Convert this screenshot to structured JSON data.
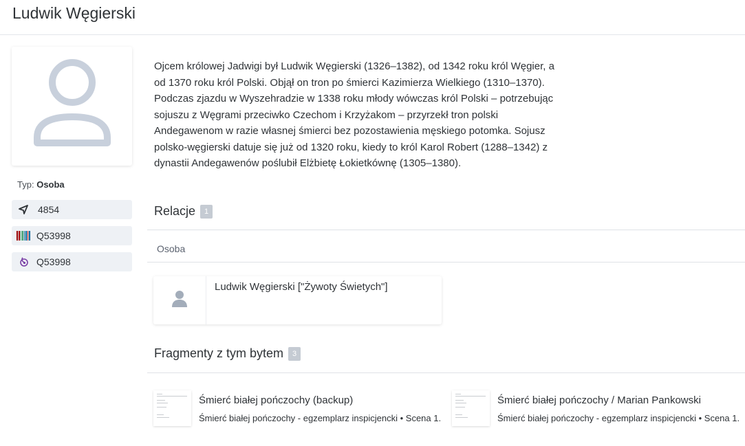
{
  "page": {
    "title": "Ludwik Węgierski"
  },
  "sidebar": {
    "type_label": "Typ:",
    "type_value": "Osoba",
    "identifiers": [
      {
        "icon": "network-icon",
        "value": "4854"
      },
      {
        "icon": "wikidata-icon",
        "value": "Q53998"
      },
      {
        "icon": "wikibase-icon",
        "value": "Q53998"
      }
    ]
  },
  "bio": "Ojcem królowej Jadwigi był Ludwik Węgierski (1326–1382), od 1342 roku król Węgier, a od 1370 roku król Polski. Objął on tron po śmierci Kazimierza Wielkiego (1310–1370). Podczas zjazdu w Wyszehradzie w 1338 roku młody wówczas król Polski – potrzebując sojuszu z Węgrami przeciwko Czechom i Krzyżakom – przyrzekł tron polski Andegawenom w razie własnej śmierci bez pozostawienia męskiego potomka. Sojusz polsko-węgierski datuje się już od 1320 roku, kiedy to król Karol Robert (1288–1342) z dynastii Andegawenów poślubił Elżbietę Łokietkównę (1305–1380).",
  "relations": {
    "title": "Relacje",
    "count": "1",
    "column": "Osoba",
    "items": [
      {
        "name": "Ludwik Węgierski [\"Żywoty Świetych\"]"
      }
    ]
  },
  "fragments": {
    "title": "Fragmenty z tym bytem",
    "count": "3",
    "items": [
      {
        "title": "Śmierć białej pończochy (backup)",
        "desc": "Śmierć białej pończochy - egzemplarz inspicjencki • Scena 1."
      },
      {
        "title": "Śmierć białej pończochy / Marian Pankowski",
        "desc": "Śmierć białej pończochy - egzemplarz inspicjencki • Scena 1."
      }
    ]
  },
  "colors": {
    "accent_badge": "#c5cbd3",
    "avatar": "#c8d0dc",
    "pill_bg": "#eef1f5",
    "wikibase_icon": "#7a3fa6"
  }
}
